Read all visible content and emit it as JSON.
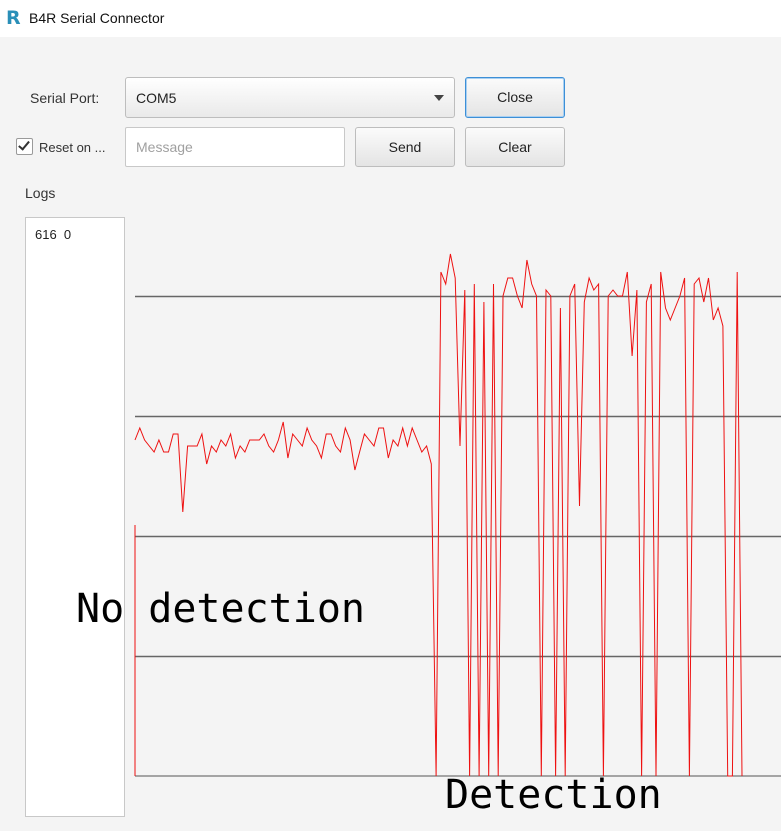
{
  "window": {
    "app_icon": "R",
    "title": "B4R Serial Connector"
  },
  "controls": {
    "serial_port_label": "Serial Port:",
    "serial_port_value": "COM5",
    "close_label": "Close",
    "reset_label": "Reset on ...",
    "reset_checked": true,
    "message_placeholder": "Message",
    "message_value": "",
    "send_label": "Send",
    "clear_label": "Clear"
  },
  "logs": {
    "label": "Logs",
    "lines": [
      "616  0"
    ]
  },
  "annotations": {
    "no_detection": "No detection",
    "detection": "Detection"
  },
  "colors": {
    "signal": "#ee1111",
    "grid": "#666666",
    "focus": "#3d8fd6"
  },
  "chart_data": {
    "type": "line",
    "series": [
      {
        "values": [
          0.56,
          0.58,
          0.56,
          0.55,
          0.54,
          0.56,
          0.54,
          0.54,
          0.57,
          0.57,
          0.44,
          0.55,
          0.55,
          0.55,
          0.57,
          0.52,
          0.55,
          0.54,
          0.56,
          0.55,
          0.57,
          0.53,
          0.55,
          0.54,
          0.56,
          0.56,
          0.56,
          0.57,
          0.55,
          0.54,
          0.56,
          0.59,
          0.53,
          0.57,
          0.56,
          0.55,
          0.58,
          0.56,
          0.55,
          0.53,
          0.57,
          0.57,
          0.55,
          0.54,
          0.58,
          0.56,
          0.51,
          0.54,
          0.57,
          0.56,
          0.55,
          0.58,
          0.58,
          0.53,
          0.56,
          0.55,
          0.58,
          0.55,
          0.58,
          0.56,
          0.54,
          0.55,
          0.52,
          0.0,
          0.84,
          0.82,
          0.87,
          0.83,
          0.55,
          0.81,
          0.0,
          0.82,
          0.0,
          0.79,
          0.0,
          0.82,
          0.0,
          0.8,
          0.83,
          0.83,
          0.8,
          0.78,
          0.86,
          0.82,
          0.8,
          0.0,
          0.81,
          0.8,
          0.0,
          0.78,
          0.0,
          0.8,
          0.82,
          0.45,
          0.79,
          0.83,
          0.81,
          0.82,
          0.0,
          0.8,
          0.81,
          0.8,
          0.8,
          0.84,
          0.7,
          0.81,
          0.0,
          0.79,
          0.82,
          0.0,
          0.84,
          0.78,
          0.76,
          0.78,
          0.8,
          0.83,
          0.0,
          0.82,
          0.83,
          0.79,
          0.83,
          0.76,
          0.78,
          0.75,
          0.0,
          0.0,
          0.84,
          0.0
        ]
      }
    ],
    "ylim": [
      0,
      1
    ],
    "grid": true,
    "gridlines": [
      0.2,
      0.4,
      0.6,
      0.8
    ]
  }
}
